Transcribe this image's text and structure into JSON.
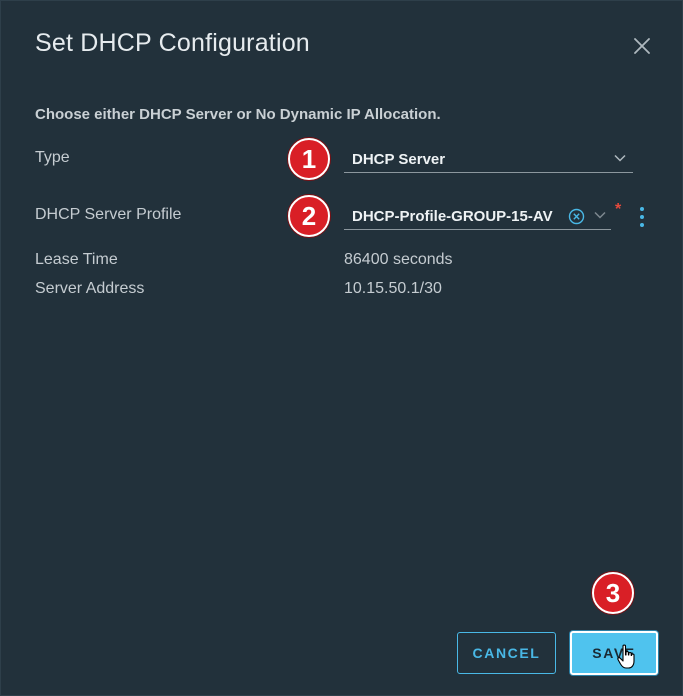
{
  "dialog": {
    "title": "Set DHCP Configuration",
    "intro": "Choose either DHCP Server or No Dynamic IP Allocation."
  },
  "form": {
    "type_label": "Type",
    "type_value": "DHCP Server",
    "profile_label": "DHCP Server Profile",
    "profile_value": "DHCP-Profile-GROUP-15-AV",
    "required_mark": "*",
    "lease_label": "Lease Time",
    "lease_value": "86400 seconds",
    "address_label": "Server Address",
    "address_value": "10.15.50.1/30"
  },
  "buttons": {
    "cancel": "CANCEL",
    "save": "SAVE"
  },
  "annotations": [
    "1",
    "2",
    "3"
  ],
  "icons": {
    "close": "close-icon",
    "chevron": "chevron-down-icon",
    "clear": "clear-circle-icon",
    "kebab": "kebab-menu-icon",
    "cursor": "hand-pointer-icon"
  },
  "colors": {
    "background": "#22313b",
    "accent": "#49b8e6",
    "primary_button": "#4fc3ee",
    "badge": "#d91f26",
    "required": "#e64a3c"
  }
}
